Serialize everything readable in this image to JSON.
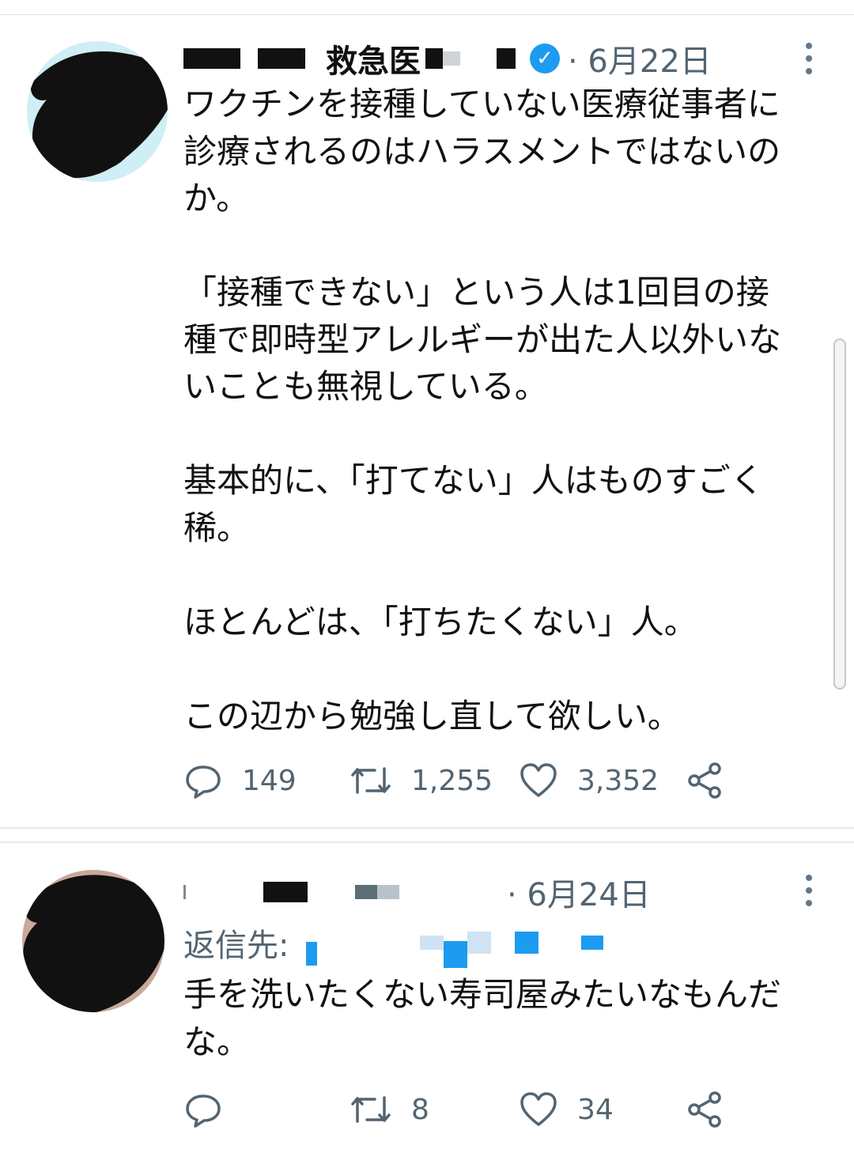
{
  "tweets": [
    {
      "author_name_visible": "救急医",
      "date": "· 6月22日",
      "text": "ワクチンを接種していない医療従事者に\n診療されるのはハラスメントではないの\nか。\n\n「接種できない」という人は1回目の接\n種で即時型アレルギーが出た人以外いな\nいことも無視している。\n\n基本的に、「打てない」人はものすごく\n稀。\n\nほとんどは、「打ちたくない」人。\n\nこの辺から勉強し直して欲しい。",
      "replies": "149",
      "retweets": "1,255",
      "likes": "3,352"
    },
    {
      "date": "· 6月24日",
      "reply_to_label": "返信先:",
      "text": "手を洗いたくない寿司屋みたいなもんだ\nな。",
      "replies": "",
      "retweets": "8",
      "likes": "34"
    }
  ],
  "icons": {
    "verified": "verified-badge-icon",
    "more": "more-vertical-icon",
    "reply": "reply-icon",
    "retweet": "retweet-icon",
    "like": "heart-icon",
    "share": "share-icon"
  },
  "colors": {
    "verified_blue": "#1d9bf0",
    "meta_gray": "#536471",
    "divider": "#e6e9ec"
  }
}
